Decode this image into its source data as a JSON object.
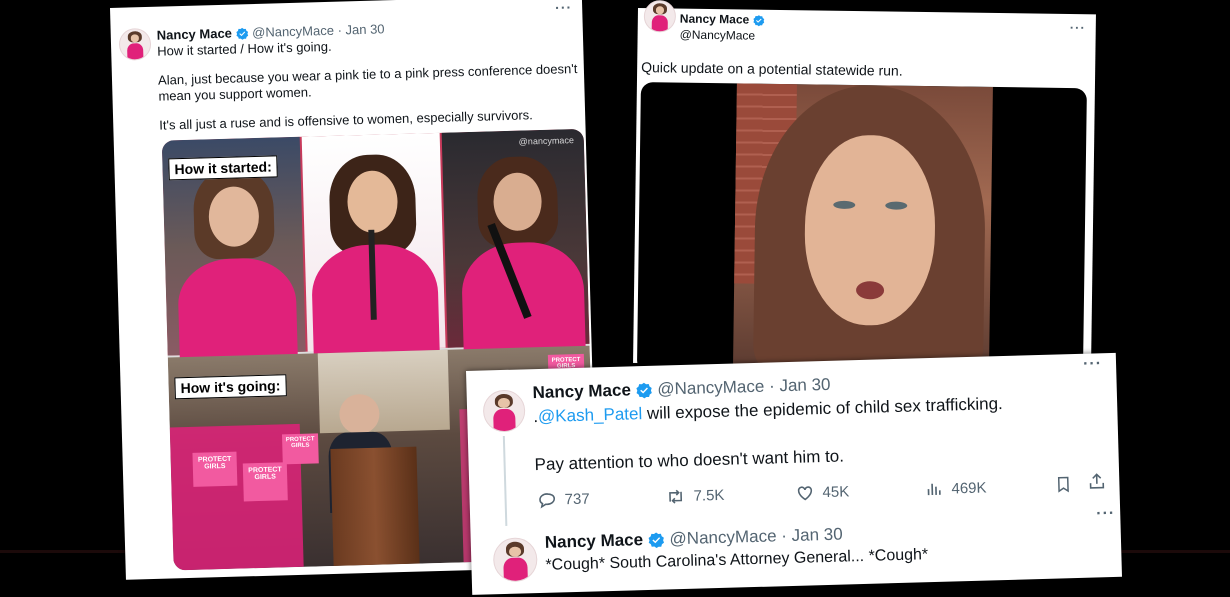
{
  "tweet_left": {
    "name": "Nancy Mace",
    "handle": "@NancyMace",
    "date": "· Jan 30",
    "line1": "How it started / How it's going.",
    "line2a": "Alan, just because you wear a pink tie to a pink press conference doesn't",
    "line2b": "mean you support women.",
    "line3": "It's all just a ruse and is offensive to women, especially survivors.",
    "image": {
      "watermark": "@nancymace",
      "top_label": "How it started:",
      "bottom_label": "How it's going:",
      "signs": [
        "PROTECT GIRLS",
        "PROTECT GIRLS",
        "PROTECT GIRLS",
        "PROTECT GIRLS"
      ]
    },
    "more": "···"
  },
  "tweet_right": {
    "name": "Nancy Mace",
    "handle": "@NancyMace",
    "text": "Quick update on a potential statewide run.",
    "more": "···"
  },
  "tweet_bottom": {
    "name": "Nancy Mace",
    "handle": "@NancyMace",
    "date": "· Jan 30",
    "mention_prefix": ".",
    "mention": "@Kash_Patel",
    "text1": " will expose the epidemic of child sex trafficking.",
    "text2": "Pay attention to who doesn't want him to.",
    "stats": {
      "replies": "737",
      "reposts": "7.5K",
      "likes": "45K",
      "views": "469K"
    },
    "more": "···"
  },
  "tweet_reply": {
    "name": "Nancy Mace",
    "handle": "@NancyMace",
    "date": "· Jan 30",
    "text": "*Cough* South Carolina's Attorney General... *Cough*",
    "more": "···"
  },
  "colors": {
    "verified": "#1d9bf0",
    "link": "#1d9bf0",
    "pink": "#e0217a",
    "muted": "#536471"
  }
}
